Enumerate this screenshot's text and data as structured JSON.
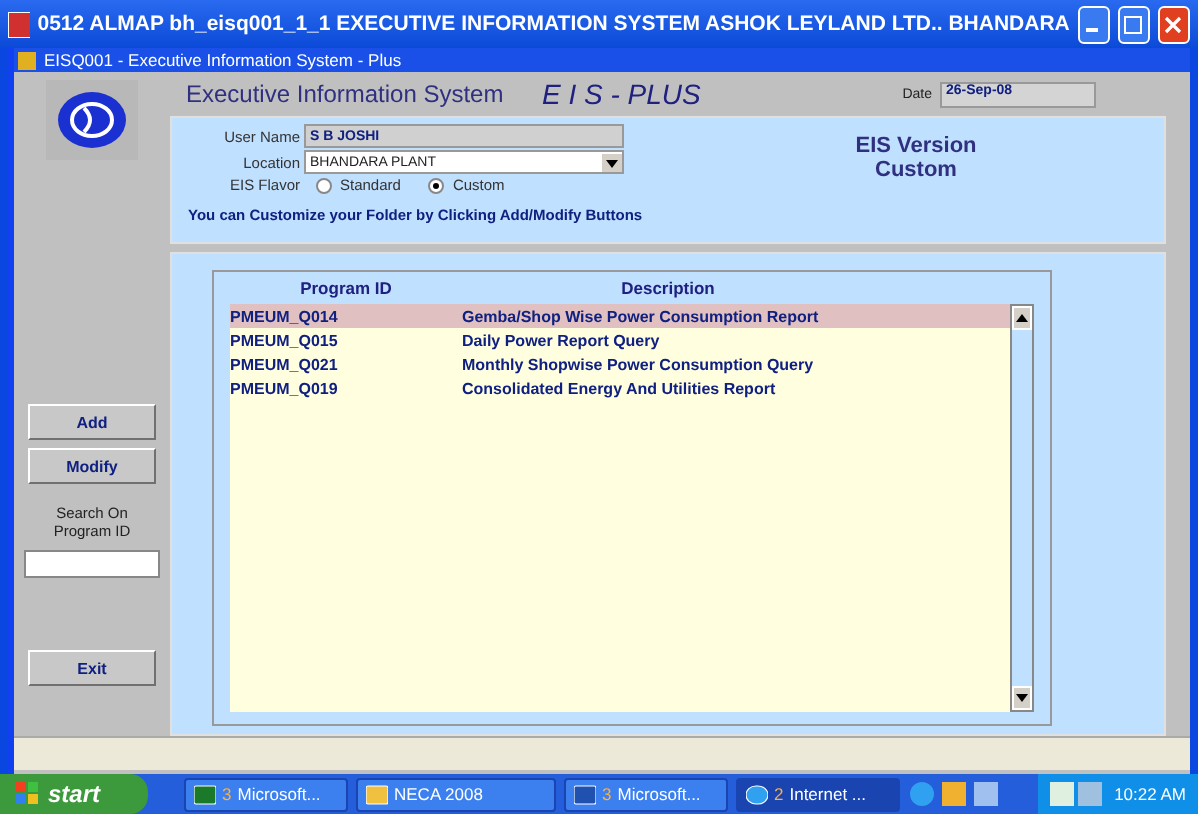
{
  "window": {
    "title": "0512 ALMAP bh_eisq001_1_1 EXECUTIVE INFORMATION SYSTEM ASHOK LEYLAND LTD.. BHANDARA"
  },
  "form": {
    "title": "EISQ001 - Executive Information System - Plus"
  },
  "header": {
    "system_name": "Executive Information System",
    "product": "E I S - PLUS",
    "date_label": "Date",
    "date": "26-Sep-08"
  },
  "user": {
    "user_name_label": "User Name",
    "user_name": "S B JOSHI",
    "location_label": "Location",
    "location": "BHANDARA PLANT",
    "flavor_label": "EIS Flavor",
    "flavors": [
      {
        "label": "Standard",
        "selected": false
      },
      {
        "label": "Custom",
        "selected": true
      }
    ],
    "hint": "You can Customize your Folder by Clicking Add/Modify Buttons",
    "version_title": "EIS Version",
    "version": "Custom"
  },
  "sidebar": {
    "buttons": [
      "Add",
      "Modify"
    ],
    "search_label": "Search On Program ID",
    "exit": "Exit"
  },
  "table": {
    "columns": [
      "Program ID",
      "Description"
    ],
    "rows": [
      {
        "id": "PMEUM_Q014",
        "description": "Gemba/Shop Wise Power Consumption Report",
        "selected": true
      },
      {
        "id": "PMEUM_Q015",
        "description": "Daily Power Report Query",
        "selected": false
      },
      {
        "id": "PMEUM_Q021",
        "description": "Monthly Shopwise Power Consumption Query",
        "selected": false
      },
      {
        "id": "PMEUM_Q019",
        "description": "Consolidated Energy And Utilities Report",
        "selected": false
      }
    ]
  },
  "taskbar": {
    "start": "start",
    "tasks": [
      {
        "kind": "excel",
        "count": "3",
        "label": "Microsoft...",
        "active": false
      },
      {
        "kind": "folder",
        "label": "NECA 2008",
        "active": false
      },
      {
        "kind": "word",
        "count": "3",
        "label": "Microsoft...",
        "active": false
      },
      {
        "kind": "ie",
        "count": "2",
        "label": "Internet ...",
        "active": true
      }
    ],
    "clock": "10:22 AM"
  }
}
